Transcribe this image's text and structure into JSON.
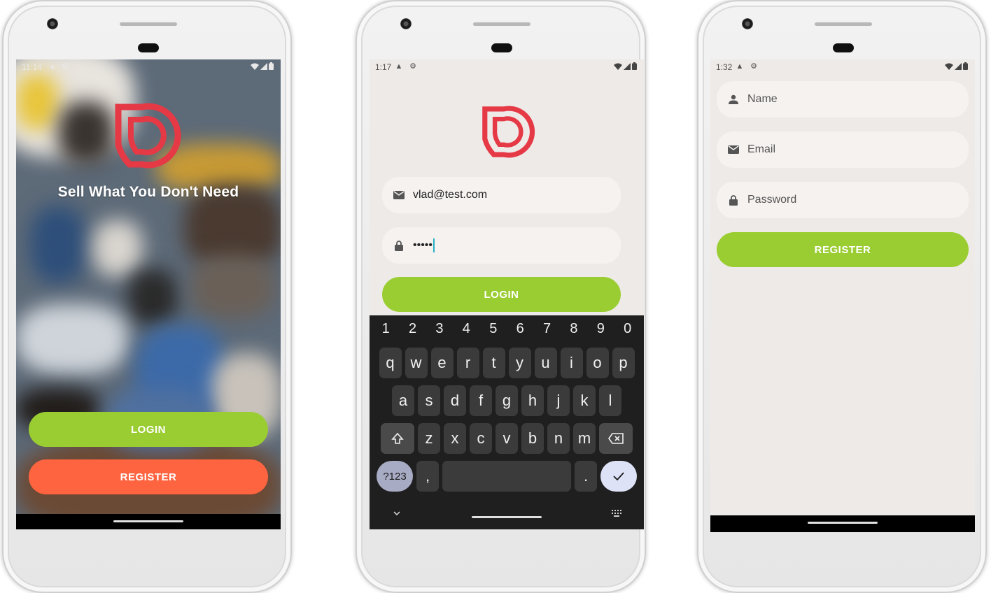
{
  "colors": {
    "green": "#9acd32",
    "orange": "#ff6440",
    "brand_red": "#e53946",
    "screen_bg": "#eeeae8",
    "field_bg": "#f6f2f0"
  },
  "welcome_screen": {
    "status_time": "11:14",
    "tagline": "Sell What You Don't Need",
    "login_label": "LOGIN",
    "register_label": "REGISTER"
  },
  "login_screen": {
    "status_time": "1:17",
    "email_value": "vlad@test.com",
    "password_value": "•••••",
    "login_label": "LOGIN",
    "keyboard": {
      "numbers": [
        "1",
        "2",
        "3",
        "4",
        "5",
        "6",
        "7",
        "8",
        "9",
        "0"
      ],
      "row1": [
        "q",
        "w",
        "e",
        "r",
        "t",
        "y",
        "u",
        "i",
        "o",
        "p"
      ],
      "row2": [
        "a",
        "s",
        "d",
        "f",
        "g",
        "h",
        "j",
        "k",
        "l"
      ],
      "row3": [
        "z",
        "x",
        "c",
        "v",
        "b",
        "n",
        "m"
      ],
      "symbols_key": "?123",
      "comma_key": ",",
      "period_key": "."
    }
  },
  "register_screen": {
    "status_time": "1:32",
    "name_placeholder": "Name",
    "email_placeholder": "Email",
    "password_placeholder": "Password",
    "register_label": "REGISTER"
  },
  "icons": [
    "camera-icon",
    "wifi-icon",
    "signal-icon",
    "battery-icon",
    "email-icon",
    "lock-icon",
    "person-icon",
    "shift-icon",
    "backspace-icon",
    "check-icon",
    "chevron-down-icon",
    "keyboard-icon"
  ]
}
